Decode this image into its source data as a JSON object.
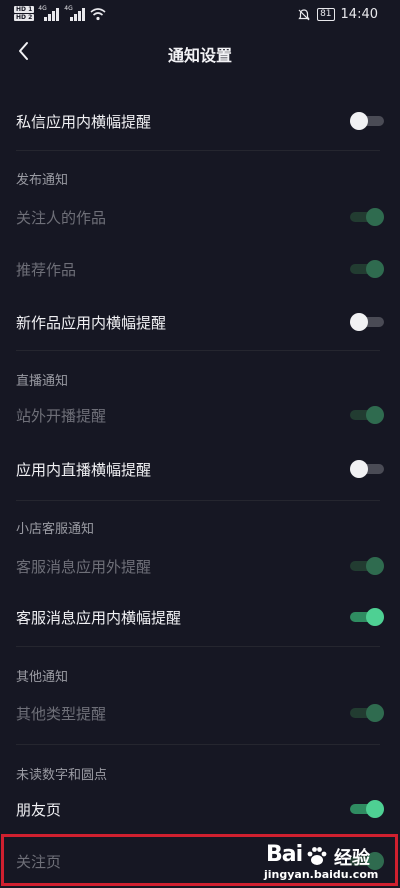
{
  "status_bar": {
    "hd1": "HD 1",
    "hd2": "HD 2",
    "net1": "4G",
    "net2": "4G",
    "battery": "81",
    "time": "14:40"
  },
  "header": {
    "title": "通知设置"
  },
  "items": [
    {
      "label": "私信应用内横幅提醒",
      "state": "off",
      "disabled": false
    },
    {
      "label": "关注人的作品",
      "state": "on",
      "disabled": true
    },
    {
      "label": "推荐作品",
      "state": "on",
      "disabled": true
    },
    {
      "label": "新作品应用内横幅提醒",
      "state": "off",
      "disabled": false
    },
    {
      "label": "站外开播提醒",
      "state": "on",
      "disabled": true
    },
    {
      "label": "应用内直播横幅提醒",
      "state": "off",
      "disabled": false
    },
    {
      "label": "客服消息应用外提醒",
      "state": "on",
      "disabled": true
    },
    {
      "label": "客服消息应用内横幅提醒",
      "state": "on",
      "disabled": false
    },
    {
      "label": "其他类型提醒",
      "state": "on",
      "disabled": true
    },
    {
      "label": "朋友页",
      "state": "on",
      "disabled": false
    },
    {
      "label": "关注页",
      "state": "on",
      "disabled": true
    }
  ],
  "sections": {
    "publish": "发布通知",
    "live": "直播通知",
    "shop": "小店客服通知",
    "other": "其他通知",
    "unread": "未读数字和圆点"
  },
  "watermark": {
    "brand": "Bai",
    "text": "经验",
    "url": "jingyan.baidu.com"
  },
  "colors": {
    "background": "#161723",
    "toggle_on": "#4ed093",
    "highlight": "#d0202f"
  }
}
